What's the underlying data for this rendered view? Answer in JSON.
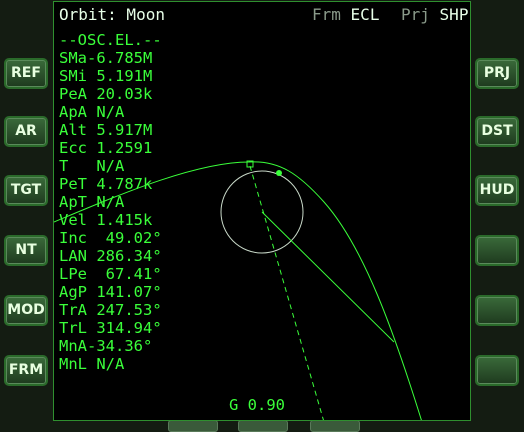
{
  "colors": {
    "accent_green": "#3aff3a",
    "title_white": "#e8ffe8",
    "dim_label": "#8a9a8a",
    "background": "#000000",
    "frame": "#141c12"
  },
  "header": {
    "title": "Orbit: Moon",
    "frame_label": "Frm",
    "frame_value": "ECL",
    "projection_label": "Prj",
    "projection_value": "SHP"
  },
  "elements_header": "--OSC.EL.--",
  "elements": [
    "SMa-6.785M",
    "SMi 5.191M",
    "PeA 20.03k",
    "ApA N/A",
    "Alt 5.917M",
    "Ecc 1.2591",
    "T   N/A",
    "PeT 4.787k",
    "ApT N/A",
    "Vel 1.415k",
    "Inc  49.02°",
    "LAN 286.34°",
    "LPe  67.41°",
    "AgP 141.07°",
    "TrA 247.53°",
    "TrL 314.94°",
    "MnA-34.36°",
    "MnL N/A"
  ],
  "g_readout": "G 0.90",
  "left_buttons": [
    "REF",
    "AR",
    "TGT",
    "NT",
    "MOD",
    "FRM"
  ],
  "right_buttons": [
    "PRJ",
    "DST",
    "HUD",
    "",
    "",
    ""
  ],
  "icons": {
    "apsis_marker": "square-marker-icon",
    "vessel_marker": "dot-marker-icon"
  }
}
